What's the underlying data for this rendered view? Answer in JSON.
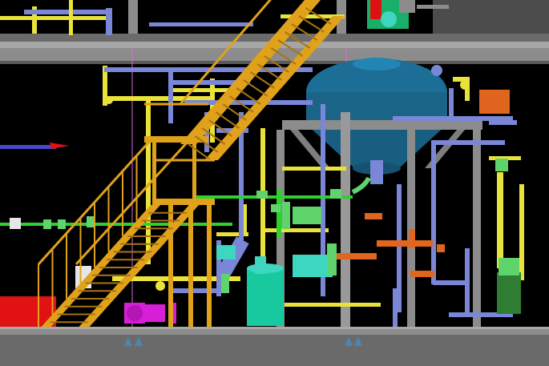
{
  "scene": {
    "background": "#000000",
    "colors": {
      "steel": "#8c8c8c",
      "steel_dark": "#5e5e5e",
      "stair": "#e0a21a",
      "stair_dark": "#a87412",
      "pipe_yellow": "#e8e23a",
      "pipe_blue": "#7a86d6",
      "pipe_green": "#2fd12f",
      "valve_green": "#5ed46a",
      "vessel_blue": "#1c6e96",
      "cyan_tank": "#18c9a0",
      "teal": "#3dd6c0",
      "orange": "#e0651e",
      "magenta": "#d61fd6",
      "red_block": "#e01212",
      "guide_line": "#d86bd8",
      "white_box": "#e6e6e6"
    },
    "icons": [
      "magenta-pump-icon",
      "orange-instrument-box-icon",
      "green-valve-icon"
    ]
  }
}
